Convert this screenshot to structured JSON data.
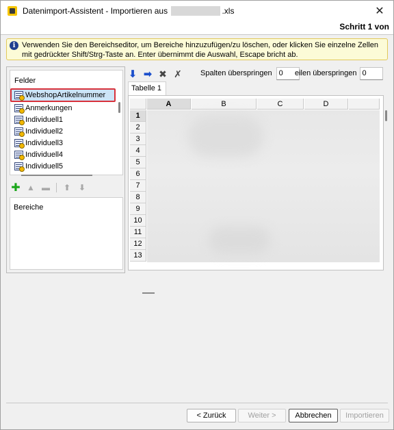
{
  "window": {
    "title_prefix": "Datenimport-Assistent -  Importieren aus",
    "title_suffix": ".xls",
    "close_glyph": "✕"
  },
  "step": {
    "label": "Schritt 1 von"
  },
  "info": {
    "icon_glyph": "i",
    "text": "Verwenden Sie den Bereichseditor, um Bereiche hinzuzufügen/zu löschen, oder klicken Sie einzelne Zellen mit gedrückter Shift/Strg-Taste an. Enter übernimmt die Auswahl, Escape bricht ab."
  },
  "fields": {
    "header": "Felder",
    "items": [
      {
        "label": "WebshopArtikelnummer"
      },
      {
        "label": "Anmerkungen"
      },
      {
        "label": "Individuell1"
      },
      {
        "label": "Individuell2"
      },
      {
        "label": "Individuell3"
      },
      {
        "label": "Individuell4"
      },
      {
        "label": "Individuell5"
      }
    ]
  },
  "ranges": {
    "header": "Bereiche"
  },
  "toolbar": {
    "skip_columns_label": "Spalten überspringen",
    "skip_columns_value": "0",
    "skip_rows_label": "eilen überspringen",
    "skip_rows_value": "0"
  },
  "sheet": {
    "tab_label": "Tabelle 1",
    "columns": [
      "A",
      "B",
      "C",
      "D"
    ],
    "rows": [
      "1",
      "2",
      "3",
      "4",
      "5",
      "6",
      "7",
      "8",
      "9",
      "10",
      "11",
      "12",
      "13"
    ]
  },
  "buttons": {
    "back": "< Zurück",
    "next": "Weiter >",
    "cancel": "Abbrechen",
    "import": "Importieren"
  },
  "colors": {
    "selection_border": "#d8313b",
    "selection_fill": "#cce4f7",
    "info_fill": "#fcfbd7",
    "add_green": "#1aa61a",
    "arrow_blue": "#1b4fcc"
  }
}
